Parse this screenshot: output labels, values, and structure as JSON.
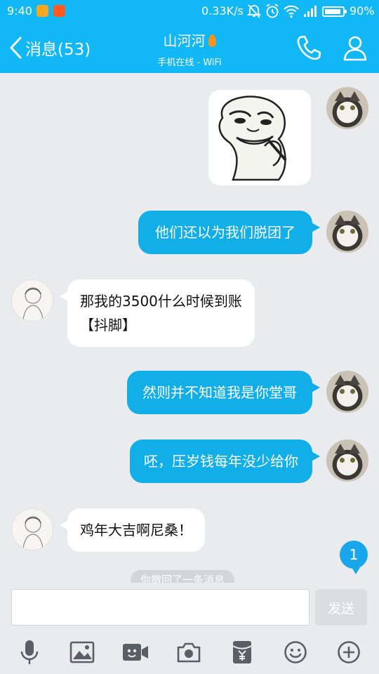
{
  "status_bar": {
    "time": "9:40",
    "net_speed": "0.33K/s",
    "battery_pct": "90%",
    "battery_level": 0.9,
    "icons": [
      "app-notification-icon",
      "taobao-icon",
      "mute-icon",
      "alarm-icon",
      "wifi-icon",
      "signal-icon",
      "battery-icon"
    ]
  },
  "header": {
    "back_label": "消息(53)",
    "contact_name": "山河河",
    "status": "手机在线 - WiFi",
    "icons": [
      "chevron-left-icon",
      "flame-icon",
      "phone-icon",
      "profile-icon"
    ]
  },
  "messages": [
    {
      "side": "out",
      "kind": "sticker",
      "sticker": "panda-face-meme-sticker"
    },
    {
      "side": "out",
      "kind": "text",
      "text": "他们还以为我们脱团了"
    },
    {
      "side": "in",
      "kind": "text",
      "lines": [
        "那我的3500什么时候到账",
        "【抖脚】"
      ]
    },
    {
      "side": "out",
      "kind": "text",
      "text": "然则并不知道我是你堂哥"
    },
    {
      "side": "out",
      "kind": "text",
      "text": "呸，压岁钱每年没少给你"
    },
    {
      "side": "in",
      "kind": "text",
      "text": "鸡年大吉啊尼桑！"
    }
  ],
  "unread_count": "1",
  "system_notice": "你撤回了一条消息",
  "composer": {
    "input_value": "",
    "send_label": "发送"
  },
  "toolbar": [
    "microphone-icon",
    "image-icon",
    "video-icon",
    "camera-icon",
    "red-packet-icon",
    "emoji-icon",
    "plus-icon"
  ],
  "colors": {
    "brand": "#12b7f5",
    "outgoing_bubble": "#12aee8",
    "incoming_bubble": "#ffffff",
    "background": "#eaebef"
  }
}
